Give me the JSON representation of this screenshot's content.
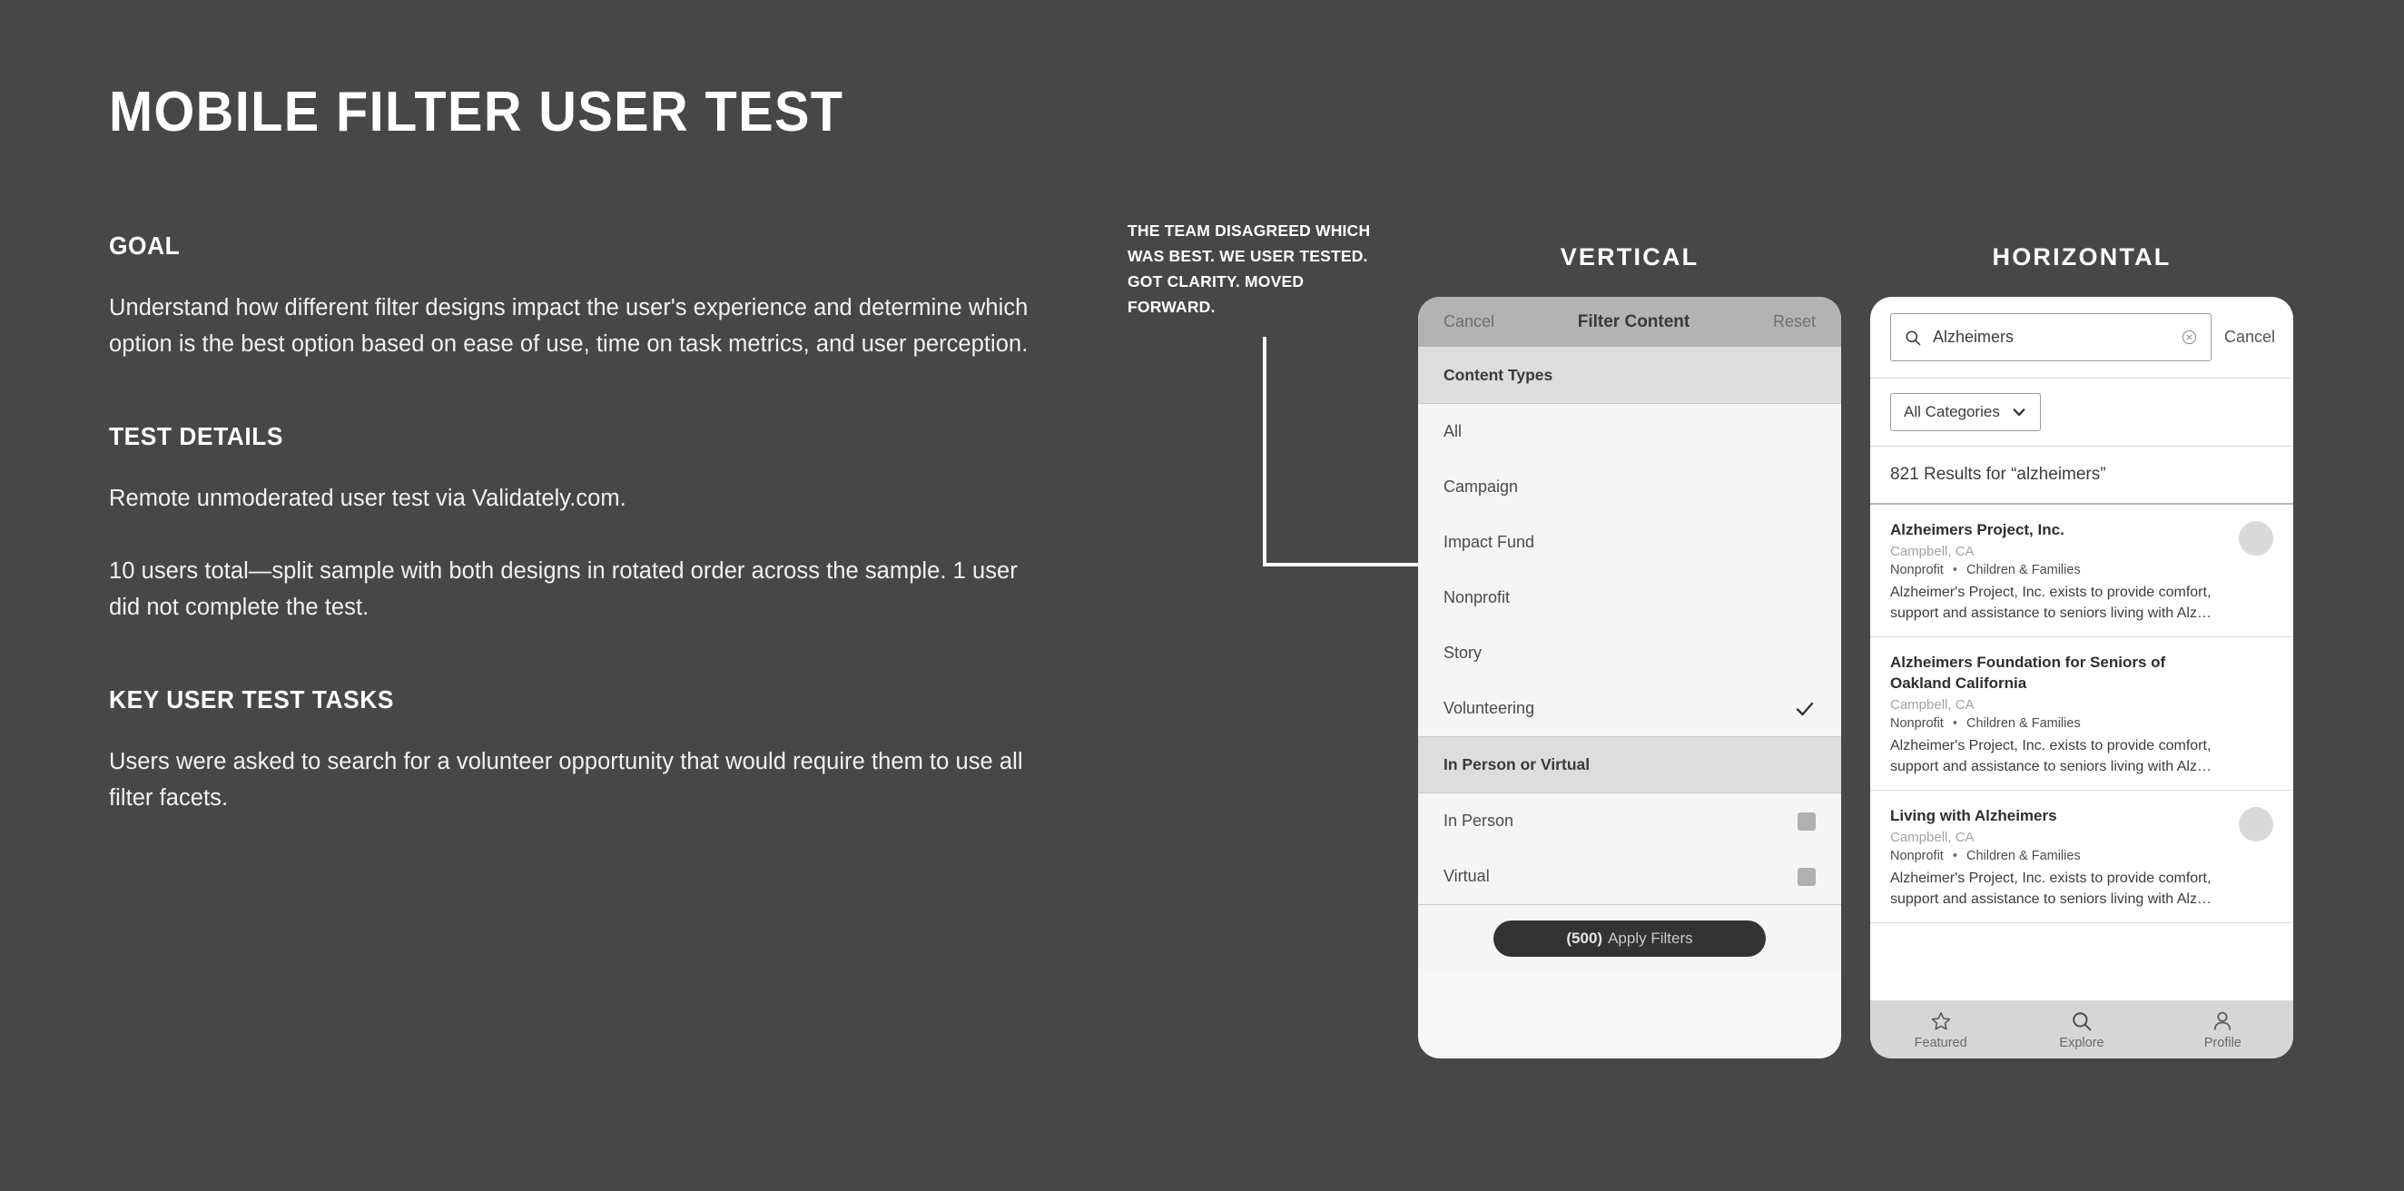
{
  "title": "MOBILE FILTER USER TEST",
  "sections": [
    {
      "heading": "GOAL",
      "body": "Understand how different filter designs impact the user's experience and determine which option is the best option based on ease of use, time on task metrics, and user perception."
    },
    {
      "heading": "TEST DETAILS",
      "body": "Remote unmoderated user test via Validately.com.",
      "body2": "10 users total—split sample with both designs in rotated order across the sample. 1 user did not complete the test."
    },
    {
      "heading": "KEY USER TEST TASKS",
      "body": "Users were asked to search for a volunteer opportunity that would require them to use all filter facets."
    }
  ],
  "callout": "THE TEAM DISAGREED WHICH WAS BEST. WE USER TESTED. GOT CLARITY. MOVED FORWARD.",
  "columns": {
    "vertical_label": "VERTICAL",
    "horizontal_label": "HORIZONTAL"
  },
  "vertical": {
    "nav": {
      "cancel": "Cancel",
      "title": "Filter Content",
      "reset": "Reset"
    },
    "group1": {
      "heading": "Content Types",
      "rows": [
        {
          "label": "All",
          "checked": false
        },
        {
          "label": "Campaign",
          "checked": false
        },
        {
          "label": "Impact Fund",
          "checked": false
        },
        {
          "label": "Nonprofit",
          "checked": false
        },
        {
          "label": "Story",
          "checked": false
        },
        {
          "label": "Volunteering",
          "checked": true
        }
      ]
    },
    "group2": {
      "heading": "In Person or Virtual",
      "rows": [
        {
          "label": "In Person"
        },
        {
          "label": "Virtual"
        }
      ]
    },
    "apply": {
      "count": "(500)",
      "label": "Apply Filters"
    }
  },
  "horizontal": {
    "search": {
      "icon": "search-icon",
      "value": "Alzheimers",
      "placeholder": "Search",
      "clear_icon": "clear-icon",
      "cancel": "Cancel"
    },
    "category": {
      "label": "All Categories",
      "chevron": "chevron-down-icon"
    },
    "results_header": "821 Results for “alzheimers”",
    "cards": [
      {
        "title": "Alzheimers Project, Inc.",
        "location": "Campbell, CA",
        "tag1": "Nonprofit",
        "tag2": "Children & Families",
        "description": "Alzheimer's Project, Inc. exists to provide comfort, support and assistance to seniors living with Alz…",
        "avatar": true
      },
      {
        "title": "Alzheimers Foundation for Seniors of Oakland  California",
        "location": "Campbell, CA",
        "tag1": "Nonprofit",
        "tag2": "Children & Families",
        "description": "Alzheimer's Project, Inc. exists to provide comfort, support and assistance to seniors living with Alz…",
        "avatar": false
      },
      {
        "title": "Living with Alzheimers",
        "location": "Campbell, CA",
        "tag1": "Nonprofit",
        "tag2": "Children & Families",
        "description": "Alzheimer's Project, Inc. exists to provide comfort, support and assistance to seniors living with Alz…",
        "avatar": true
      }
    ],
    "tabs": [
      {
        "label": "Featured",
        "icon": "star-icon"
      },
      {
        "label": "Explore",
        "icon": "search-icon"
      },
      {
        "label": "Profile",
        "icon": "person-icon"
      }
    ]
  },
  "colors": {
    "background": "#474747",
    "text_light": "#ffffff",
    "phone_surface": "#f5f5f5",
    "apply_button": "#333333"
  }
}
